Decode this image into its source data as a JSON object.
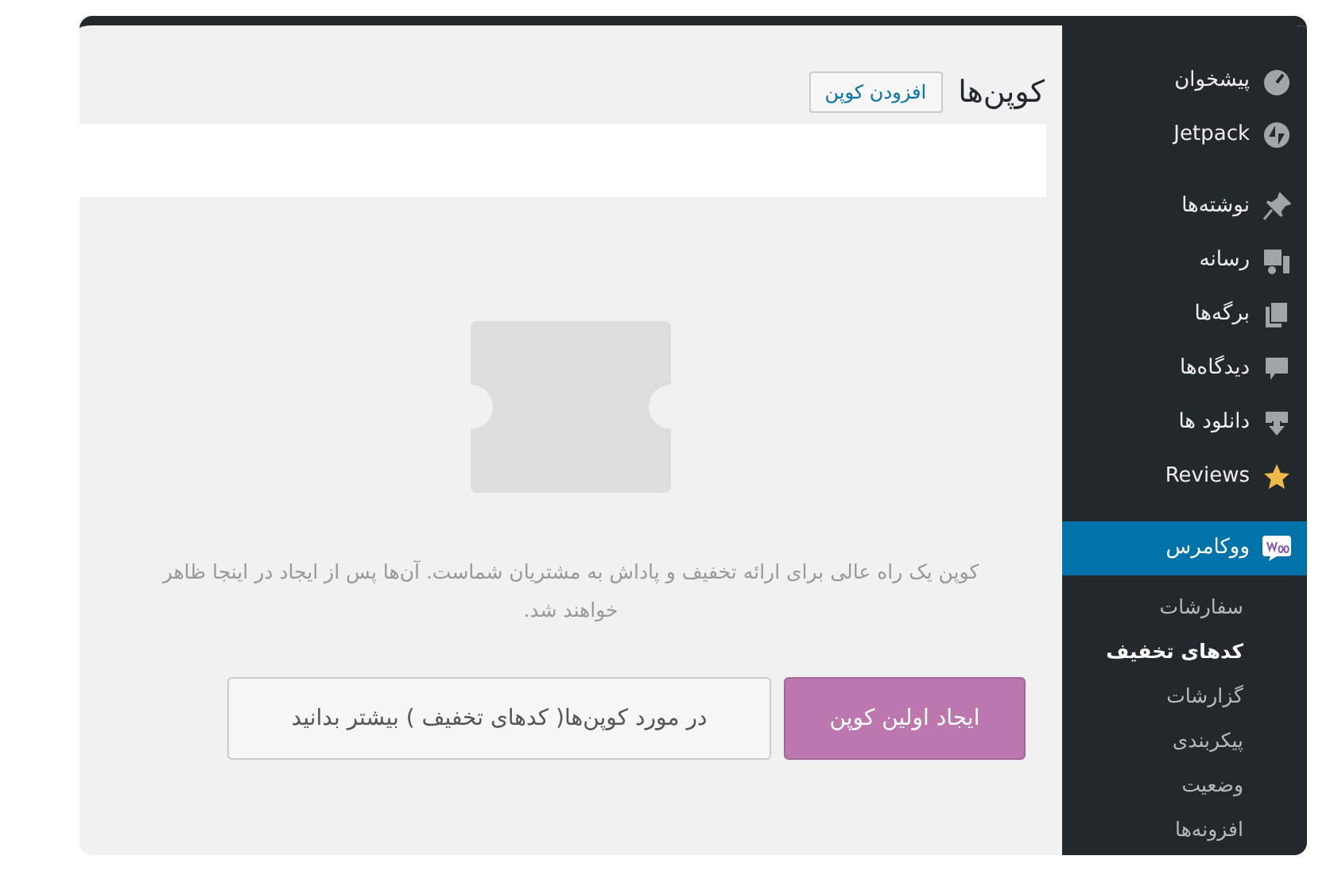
{
  "sidebar": {
    "groups": [
      [
        {
          "label": "پیشخوان",
          "selected": false
        },
        {
          "label": "Jetpack",
          "selected": false
        }
      ],
      [
        {
          "label": "نوشته‌ها",
          "selected": false
        },
        {
          "label": "رسانه",
          "selected": false
        },
        {
          "label": "برگه‌ها",
          "selected": false
        },
        {
          "label": "دیدگاه‌ها",
          "selected": false
        },
        {
          "label": "دانلود ها",
          "selected": false
        },
        {
          "label": "Reviews",
          "selected": false
        }
      ],
      [
        {
          "label": "ووکامرس",
          "selected": true,
          "children": [
            {
              "label": "سفارشات",
              "selected": false
            },
            {
              "label": "کدهای تخفیف",
              "selected": true
            },
            {
              "label": "گزارشات",
              "selected": false
            },
            {
              "label": "پیکربندی",
              "selected": false
            },
            {
              "label": "وضعیت",
              "selected": false
            },
            {
              "label": "افزونه‌ها",
              "selected": false
            }
          ]
        }
      ]
    ]
  },
  "page": {
    "title": "کوپن‌ها",
    "add_button": "افزودن کوپن"
  },
  "empty_state": {
    "message": "کوپن یک راه عالی برای ارائه تخفیف و پاداش به مشتریان شماست. آن‌ها پس از ایجاد در اینجا ظاهر خواهند شد.",
    "primary_button": "ایجاد اولین کوپن",
    "secondary_button": "در مورد کوپن‌ها( کدهای تخفیف ) بیشتر بدانید"
  }
}
